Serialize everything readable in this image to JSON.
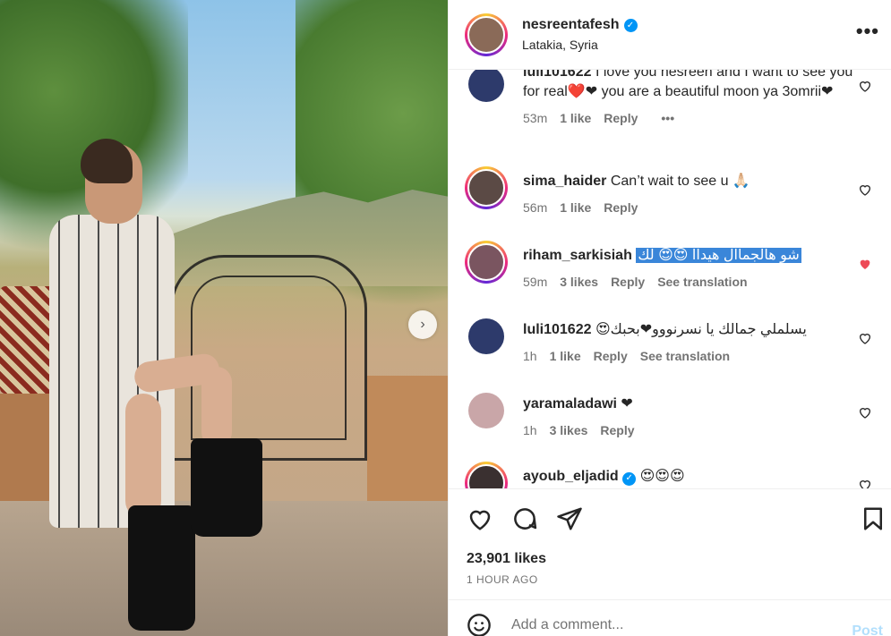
{
  "post": {
    "username": "nesreentafesh",
    "location": "Latakia, Syria",
    "likes": "23,901 likes",
    "time": "1 HOUR AGO"
  },
  "comments": [
    {
      "username": "luli101622",
      "text": "I love you nesreen and I want to see you for real❤️❤ you are a beautiful moon ya 3omrii❤",
      "time": "53m",
      "likes": "1 like",
      "reply": "Reply",
      "more": "•••",
      "avatar_color": "#2d3a6b",
      "liked": false
    },
    {
      "username": "sima_haider",
      "text": "Can’t wait to see u 🙏🏻",
      "time": "56m",
      "likes": "1 like",
      "reply": "Reply",
      "avatar_color": "#5b4a45",
      "liked": false
    },
    {
      "username": "riham_sarkisiah",
      "text": "شو هالجماال هيداا 😍😍 لك",
      "time": "59m",
      "likes": "3 likes",
      "reply": "Reply",
      "translate": "See translation",
      "avatar_color": "#7a5560",
      "liked": true
    },
    {
      "username": "luli101622",
      "text": "يسلملي جمالك يا نسرنووو❤بحبك😍",
      "time": "1h",
      "likes": "1 like",
      "reply": "Reply",
      "translate": "See translation",
      "avatar_color": "#2d3a6b",
      "liked": false
    },
    {
      "username": "yaramaladawi",
      "text": "❤",
      "time": "1h",
      "likes": "3 likes",
      "reply": "Reply",
      "avatar_color": "#c9a6a8",
      "liked": false
    },
    {
      "username": "ayoub_eljadid",
      "text": "😍😍😍",
      "avatar_color": "#3a3030",
      "liked": false
    }
  ],
  "add_comment": {
    "placeholder": "Add a comment...",
    "post_label": "Post"
  },
  "colors": {
    "accent": "#0095f6",
    "liked_heart": "#ed4956",
    "muted": "#737373"
  }
}
